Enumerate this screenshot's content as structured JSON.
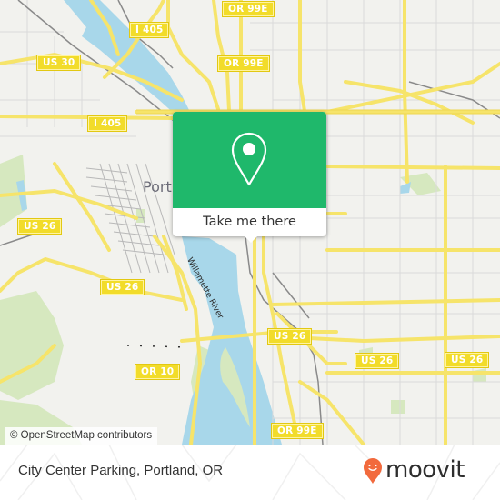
{
  "map": {
    "city_label": "Portland",
    "river_label": "Willamette River",
    "shields": [
      {
        "id": "or99e-top",
        "text": "OR 99E"
      },
      {
        "id": "i405-top",
        "text": "I 405"
      },
      {
        "id": "us30",
        "text": "US 30"
      },
      {
        "id": "or99e-mid",
        "text": "OR 99E"
      },
      {
        "id": "i405-mid",
        "text": "I 405"
      },
      {
        "id": "us26-west",
        "text": "US 26"
      },
      {
        "id": "us26-sw",
        "text": "US 26"
      },
      {
        "id": "or10",
        "text": "OR 10"
      },
      {
        "id": "us26-center",
        "text": "US 26"
      },
      {
        "id": "us26-east1",
        "text": "US 26"
      },
      {
        "id": "us26-east2",
        "text": "US 26"
      },
      {
        "id": "or99e-bottom",
        "text": "OR 99E"
      }
    ],
    "attribution": "© OpenStreetMap contributors",
    "colors": {
      "land": "#f2f2ee",
      "water": "#a8d7ea",
      "park": "#d6e8bf",
      "highway": "#f6e46a",
      "rail": "#8a8a8a"
    }
  },
  "popup": {
    "icon": "location-pin-icon",
    "action_label": "Take me there",
    "color": "#1fb86b"
  },
  "footer": {
    "place_name": "City Center Parking, Portland, OR",
    "brand": "moovit",
    "brand_color": "#f26a3d"
  }
}
